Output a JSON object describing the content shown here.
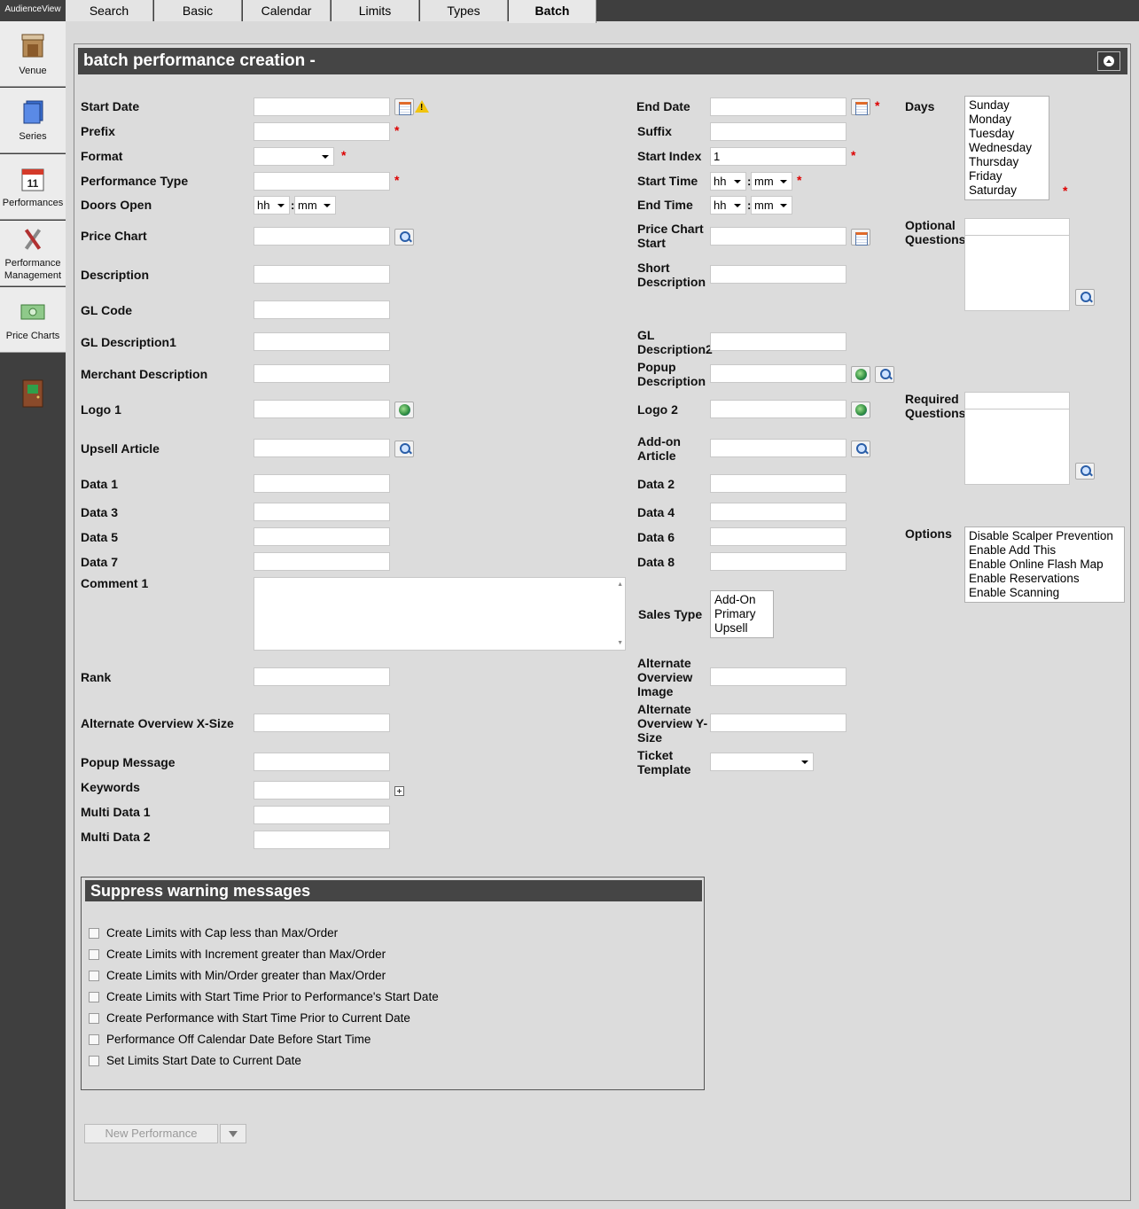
{
  "app": {
    "brand": "AudienceView"
  },
  "sidebar": {
    "items": [
      {
        "label": "Venue",
        "icon": "venue-icon"
      },
      {
        "label": "Series",
        "icon": "series-icon"
      },
      {
        "label": "Performances",
        "icon": "calendar-icon"
      },
      {
        "label": "Performance Management",
        "label_lines": [
          "Performance",
          "Management"
        ],
        "icon": "tools-icon"
      },
      {
        "label": "Price Charts",
        "icon": "money-icon"
      }
    ],
    "exit_icon": "exit-door-icon"
  },
  "tabs": [
    "Search",
    "Basic",
    "Calendar",
    "Limits",
    "Types",
    "Batch"
  ],
  "active_tab": "Batch",
  "header": {
    "title": "batch performance creation -"
  },
  "fields": {
    "start_date": {
      "label": "Start Date",
      "value": ""
    },
    "prefix": {
      "label": "Prefix",
      "value": ""
    },
    "format": {
      "label": "Format",
      "value": ""
    },
    "performance_type": {
      "label": "Performance Type",
      "value": ""
    },
    "doors_open": {
      "label": "Doors Open",
      "hh": "hh",
      "mm": "mm"
    },
    "price_chart": {
      "label": "Price Chart",
      "value": ""
    },
    "description": {
      "label": "Description",
      "value": ""
    },
    "gl_code": {
      "label": "GL Code",
      "value": ""
    },
    "gl_description1": {
      "label": "GL Description1",
      "value": ""
    },
    "merchant_description": {
      "label": "Merchant Description",
      "value": ""
    },
    "logo1": {
      "label": "Logo 1",
      "value": ""
    },
    "upsell_article": {
      "label": "Upsell Article",
      "value": ""
    },
    "data1": {
      "label": "Data 1"
    },
    "data3": {
      "label": "Data 3"
    },
    "data5": {
      "label": "Data 5"
    },
    "data7": {
      "label": "Data 7"
    },
    "comment1": {
      "label": "Comment 1"
    },
    "rank": {
      "label": "Rank"
    },
    "alt_x": {
      "label": "Alternate Overview X-Size"
    },
    "popup_message": {
      "label": "Popup Message"
    },
    "keywords": {
      "label": "Keywords"
    },
    "multi_data1": {
      "label": "Multi Data 1"
    },
    "multi_data2": {
      "label": "Multi Data 2"
    },
    "end_date": {
      "label": "End Date"
    },
    "suffix": {
      "label": "Suffix"
    },
    "start_index": {
      "label": "Start Index",
      "value": "1"
    },
    "start_time": {
      "label": "Start Time",
      "hh": "hh",
      "mm": "mm"
    },
    "end_time": {
      "label": "End Time",
      "hh": "hh",
      "mm": "mm"
    },
    "price_chart_start": {
      "label_lines": [
        "Price Chart",
        "Start"
      ]
    },
    "short_description": {
      "label_lines": [
        "Short",
        "Description"
      ]
    },
    "gl_description2": {
      "label_lines": [
        "GL",
        "Description2"
      ]
    },
    "popup_description": {
      "label_lines": [
        "Popup",
        "Description"
      ]
    },
    "logo2": {
      "label": "Logo 2"
    },
    "addon_article": {
      "label_lines": [
        "Add-on",
        "Article"
      ]
    },
    "data2": {
      "label": "Data 2"
    },
    "data4": {
      "label": "Data 4"
    },
    "data6": {
      "label": "Data 6"
    },
    "data8": {
      "label": "Data 8"
    },
    "sales_type": {
      "label": "Sales Type",
      "options": [
        "Add-On",
        "Primary",
        "Upsell"
      ]
    },
    "alt_image": {
      "label_lines": [
        "Alternate",
        "Overview",
        "Image"
      ]
    },
    "alt_y": {
      "label_lines": [
        "Alternate",
        "Overview Y-",
        "Size"
      ]
    },
    "ticket_template": {
      "label_lines": [
        "Ticket",
        "Template"
      ],
      "value": ""
    },
    "days": {
      "label": "Days",
      "options": [
        "Sunday",
        "Monday",
        "Tuesday",
        "Wednesday",
        "Thursday",
        "Friday",
        "Saturday"
      ]
    },
    "optional_questions": {
      "label_lines": [
        "Optional",
        "Questions"
      ]
    },
    "required_questions": {
      "label_lines": [
        "Required",
        "Questions"
      ]
    },
    "options": {
      "label": "Options",
      "items": [
        "Disable Scalper Prevention",
        "Enable Add This",
        "Enable Online Flash Map",
        "Enable Reservations",
        "Enable Scanning"
      ]
    }
  },
  "suppress": {
    "title": "Suppress warning messages",
    "items": [
      "Create Limits with Cap less than Max/Order",
      "Create Limits with Increment greater than Max/Order",
      "Create Limits with Min/Order greater than Max/Order",
      "Create Limits with Start Time Prior to Performance's Start Date",
      "Create Performance with Start Time Prior to Current Date",
      "Performance Off Calendar Date Before Start Time",
      "Set Limits Start Date to Current Date"
    ]
  },
  "actions": {
    "new_performance": "New Performance"
  },
  "required_marker": "*",
  "time_separator": ":"
}
